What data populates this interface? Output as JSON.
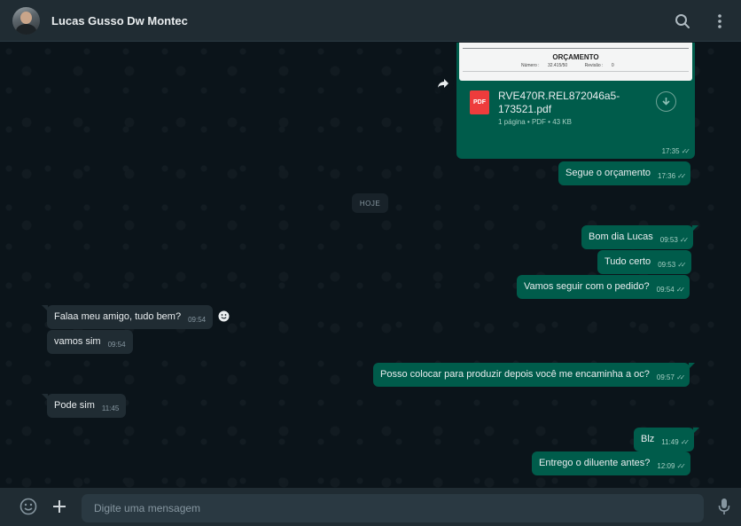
{
  "header": {
    "contact_name": "Lucas Gusso Dw Montec"
  },
  "file_message": {
    "preview_title": "ORÇAMENTO",
    "preview_number_label": "Número :",
    "preview_number": "32.415/50",
    "preview_revision_label": "Revisão :",
    "preview_revision": "0",
    "file_name": "RVE470R.REL872046a5-173521.pdf",
    "file_info": "1 página • PDF • 43 KB",
    "file_badge": "PDF",
    "time": "17:35"
  },
  "date_divider": "HOJE",
  "messages": [
    {
      "text": "Segue o orçamento",
      "time": "17:36",
      "direction": "out"
    },
    {
      "text": "Bom dia Lucas",
      "time": "09:53",
      "direction": "out"
    },
    {
      "text": "Tudo certo",
      "time": "09:53",
      "direction": "out"
    },
    {
      "text": "Vamos seguir com o pedido?",
      "time": "09:54",
      "direction": "out"
    },
    {
      "text": "Falaa meu amigo, tudo bem?",
      "time": "09:54",
      "direction": "in"
    },
    {
      "text": "vamos sim",
      "time": "09:54",
      "direction": "in"
    },
    {
      "text": "Posso colocar para produzir depois você me encaminha a oc?",
      "time": "09:57",
      "direction": "out"
    },
    {
      "text": "Pode sim",
      "time": "11:45",
      "direction": "in"
    },
    {
      "text": "Blz",
      "time": "11:49",
      "direction": "out"
    },
    {
      "text": "Entrego o diluente antes?",
      "time": "12:09",
      "direction": "out"
    }
  ],
  "composer": {
    "placeholder": "Digite uma mensagem"
  },
  "colors": {
    "outgoing": "#005c4b",
    "incoming": "#202c33",
    "background": "#0b141a",
    "header": "#202c33"
  }
}
